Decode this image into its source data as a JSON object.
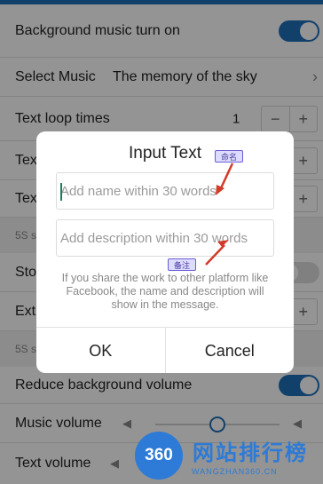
{
  "colors": {
    "accent": "#1e6fb8",
    "annotation_arrow": "#d23b2a",
    "annotation_tag_bg": "#dcdcff",
    "watermark": "#2d7bd6"
  },
  "settings": {
    "background_music_label": "Background music turn on",
    "select_music_label": "Select Music",
    "select_music_value": "The memory of the sky",
    "text_loop_label": "Text loop times",
    "text_loop_value": "1",
    "row4_label": "Tex",
    "row5_label": "Tex",
    "note1": "5S s",
    "row7_label": "Sto",
    "row8_label": "Ext",
    "note2": "5S s",
    "reduce_volume_label": "Reduce background volume",
    "music_volume_label": "Music volume",
    "music_volume_level": 0.5,
    "text_volume_label": "Text volume",
    "stepper_minus": "−",
    "stepper_plus": "+",
    "chevron": "›"
  },
  "dialog": {
    "title": "Input Text",
    "name_placeholder": "Add name within 30 words",
    "description_placeholder": "Add description within 30 words",
    "hint": "If you share the work to other platform like Facebook, the name and description will show in the message.",
    "ok_label": "OK",
    "cancel_label": "Cancel"
  },
  "annotations": {
    "name_tag": "命名",
    "description_tag": "备注"
  },
  "watermark": {
    "badge": "360",
    "title": "网站排行榜",
    "url": "WANGZHAN360.CN"
  }
}
